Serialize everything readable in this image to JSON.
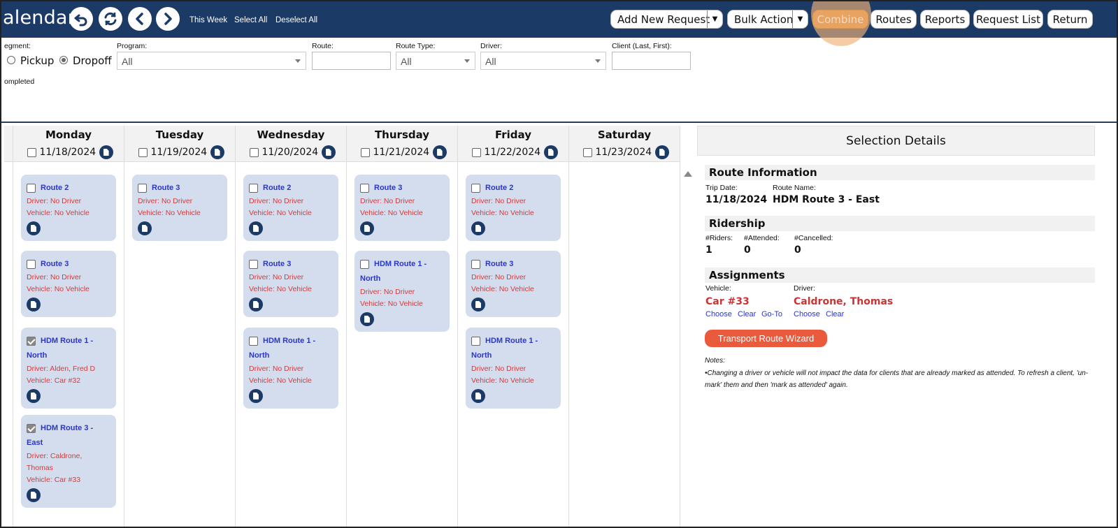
{
  "header": {
    "title": "alendar",
    "links": {
      "this_week": "This Week",
      "select_all": "Select All",
      "deselect_all": "Deselect All"
    },
    "buttons": {
      "add_new_request": "Add New Request",
      "bulk_action": "Bulk Action",
      "combine": "Combine",
      "routes": "Routes",
      "reports": "Reports",
      "request_list": "Request List",
      "return": "Return"
    }
  },
  "filters": {
    "segment_label": "egment:",
    "pickup": "Pickup",
    "dropoff": "Dropoff",
    "selected_segment": "Dropoff",
    "program_label": "Program:",
    "program_value": "All",
    "route_label": "Route:",
    "route_type_label": "Route Type:",
    "route_type_value": "All",
    "driver_label": "Driver:",
    "driver_value": "All",
    "client_label": "Client (Last, First):",
    "completed": "ompleted"
  },
  "days": [
    {
      "name": "Monday",
      "date": "11/18/2024"
    },
    {
      "name": "Tuesday",
      "date": "11/19/2024"
    },
    {
      "name": "Wednesday",
      "date": "11/20/2024"
    },
    {
      "name": "Thursday",
      "date": "11/21/2024"
    },
    {
      "name": "Friday",
      "date": "11/22/2024"
    },
    {
      "name": "Saturday",
      "date": "11/23/2024"
    }
  ],
  "routes": {
    "mon": [
      {
        "t1": "Route 2",
        "t2": "",
        "driver": "Driver: No Driver",
        "driver2": "",
        "vehicle": "Vehicle: No Vehicle",
        "checked": false
      },
      {
        "t1": "Route 3",
        "t2": "",
        "driver": "Driver: No Driver",
        "driver2": "",
        "vehicle": "Vehicle: No Vehicle",
        "checked": false
      },
      {
        "t1": "HDM Route 1 -",
        "t2": "North",
        "driver": "Driver: Alden, Fred D",
        "driver2": "",
        "vehicle": "Vehicle: Car #32",
        "checked": true
      },
      {
        "t1": "HDM Route 3 -",
        "t2": "East",
        "driver": "Driver: Caldrone,",
        "driver2": "Thomas",
        "vehicle": "Vehicle: Car #33",
        "checked": true
      }
    ],
    "tue": [
      {
        "t1": "Route 3",
        "t2": "",
        "driver": "Driver: No Driver",
        "driver2": "",
        "vehicle": "Vehicle: No Vehicle",
        "checked": false
      }
    ],
    "wed": [
      {
        "t1": "Route 2",
        "t2": "",
        "driver": "Driver: No Driver",
        "driver2": "",
        "vehicle": "Vehicle: No Vehicle",
        "checked": false
      },
      {
        "t1": "Route 3",
        "t2": "",
        "driver": "Driver: No Driver",
        "driver2": "",
        "vehicle": "Vehicle: No Vehicle",
        "checked": false
      },
      {
        "t1": "HDM Route 1 -",
        "t2": "North",
        "driver": "Driver: No Driver",
        "driver2": "",
        "vehicle": "Vehicle: No Vehicle",
        "checked": false
      }
    ],
    "thu": [
      {
        "t1": "Route 3",
        "t2": "",
        "driver": "Driver: No Driver",
        "driver2": "",
        "vehicle": "Vehicle: No Vehicle",
        "checked": false
      },
      {
        "t1": "HDM Route 1 -",
        "t2": "North",
        "driver": "Driver: No Driver",
        "driver2": "",
        "vehicle": "Vehicle: No Vehicle",
        "checked": false
      }
    ],
    "fri": [
      {
        "t1": "Route 2",
        "t2": "",
        "driver": "Driver: No Driver",
        "driver2": "",
        "vehicle": "Vehicle: No Vehicle",
        "checked": false
      },
      {
        "t1": "Route 3",
        "t2": "",
        "driver": "Driver: No Driver",
        "driver2": "",
        "vehicle": "Vehicle: No Vehicle",
        "checked": false
      },
      {
        "t1": "HDM Route 1 -",
        "t2": "North",
        "driver": "Driver: No Driver",
        "driver2": "",
        "vehicle": "Vehicle: No Vehicle",
        "checked": false
      }
    ]
  },
  "details": {
    "header": "Selection Details",
    "route_info": "Route Information",
    "trip_date_label": "Trip Date:",
    "trip_date": "11/18/2024",
    "route_name_label": "Route Name:",
    "route_name": "HDM Route 3 - East",
    "ridership": "Ridership",
    "riders_label": "#Riders:",
    "riders": "1",
    "attended_label": "#Attended:",
    "attended": "0",
    "cancelled_label": "#Cancelled:",
    "cancelled": "0",
    "assignments": "Assignments",
    "vehicle_label": "Vehicle:",
    "vehicle": "Car #33",
    "driver_label": "Driver:",
    "driver": "Caldrone, Thomas",
    "choose": "Choose",
    "clear": "Clear",
    "goto": "Go-To",
    "wizard": "Transport Route Wizard",
    "notes_label": "Notes:",
    "notes": "•Changing a driver or vehicle will not impact the data for clients that are already marked as attended. To refresh a client, 'un-mark' them and then 'mark as attended' again."
  }
}
